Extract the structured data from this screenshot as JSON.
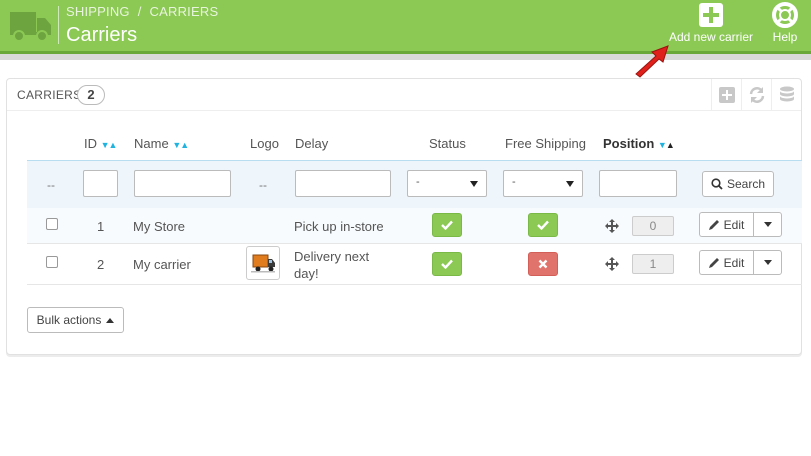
{
  "header": {
    "breadcrumb": [
      "SHIPPING",
      "CARRIERS"
    ],
    "breadcrumb_sep": "/",
    "title": "Carriers",
    "actions": {
      "add_label": "Add new carrier",
      "help_label": "Help"
    },
    "brand_color": "#8bc954"
  },
  "panel": {
    "title": "CARRIERS",
    "count": "2",
    "tools": [
      "add-icon",
      "refresh-icon",
      "database-icon"
    ]
  },
  "table": {
    "headers": {
      "id": "ID",
      "name": "Name",
      "logo": "Logo",
      "delay": "Delay",
      "status": "Status",
      "free_shipping": "Free Shipping",
      "position": "Position"
    },
    "filters": {
      "bulk_dash": "--",
      "logo_dash": "--",
      "status_value": "-",
      "free_shipping_value": "-",
      "search_label": "Search"
    },
    "rows": [
      {
        "id": "1",
        "name": "My Store",
        "delay": "Pick up in-store",
        "status": "enabled",
        "free_shipping": "yes",
        "position": "0",
        "edit_label": "Edit"
      },
      {
        "id": "2",
        "name": "My carrier",
        "delay": "Delivery next day!",
        "status": "enabled",
        "free_shipping": "no",
        "position": "1",
        "edit_label": "Edit"
      }
    ]
  },
  "footer": {
    "bulk_label": "Bulk actions"
  },
  "colors": {
    "success": "#8bc954",
    "danger": "#e0746d",
    "sort_arrow": "#1fb3e0",
    "annotation_arrow": "#e0201a"
  }
}
